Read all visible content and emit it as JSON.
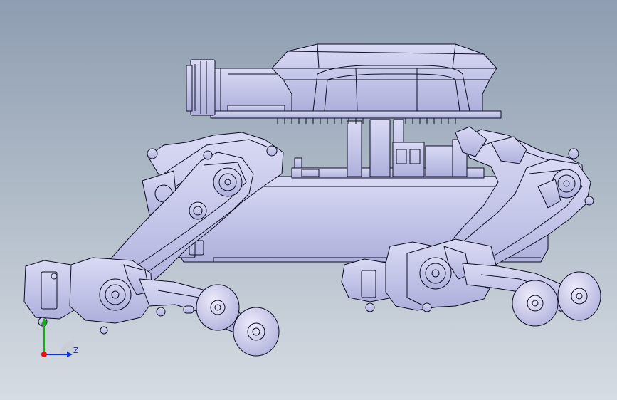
{
  "scene": {
    "model": "robot-assembly",
    "background_top": "#8e9db1",
    "background_bottom": "#d6dce3",
    "part_fill": "#c7c8ec",
    "part_stroke": "#0c0c22"
  },
  "triad": {
    "z_label": "Z",
    "x_color": "#e01010",
    "y_color": "#10b010",
    "z_color": "#1030d0"
  }
}
